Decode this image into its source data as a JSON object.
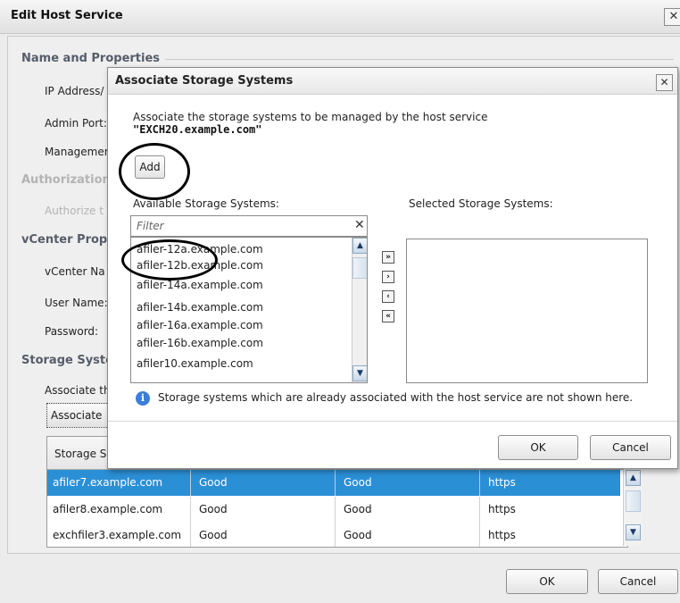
{
  "outer": {
    "title": "Edit Host Service",
    "close_glyph": "✕",
    "sections": {
      "name_properties": "Name and Properties",
      "authorization": "Authorization",
      "vcenter": "vCenter Prope",
      "storage": "Storage Syste"
    },
    "fields": {
      "ip_address": "IP Address/",
      "admin_port": "Admin Port:",
      "management": "Managemer",
      "authorize": "Authorize t",
      "vcenter_name": "vCenter Na",
      "user_name": "User Name:",
      "password": "Password:",
      "associate_text": "Associate th"
    },
    "associate_button": "Associate",
    "storage_table": {
      "header_first": "Storage S",
      "rows": [
        {
          "name": "afiler7.example.com",
          "status1": "Good",
          "status2": "Good",
          "protocol": "https",
          "selected": true
        },
        {
          "name": "afiler8.example.com",
          "status1": "Good",
          "status2": "Good",
          "protocol": "https",
          "selected": false
        },
        {
          "name": "exchfiler3.example.com",
          "status1": "Good",
          "status2": "Good",
          "protocol": "https",
          "selected": false
        }
      ]
    },
    "ok": "OK",
    "cancel": "Cancel"
  },
  "dialog": {
    "title": "Associate Storage Systems",
    "close_glyph": "✕",
    "description": "Associate the storage systems to be managed by the host service",
    "host": "\"EXCH20.example.com\"",
    "add_button": "Add",
    "available_label": "Available Storage Systems:",
    "selected_label": "Selected Storage Systems:",
    "filter_placeholder": "Filter",
    "filter_clear": "✕",
    "available": [
      "afiler-12a.example.com",
      "afiler-12b.example.com",
      "afiler-14a.example.com",
      "afiler-14b.example.com",
      "afiler-16a.example.com",
      "afiler-16b.example.com",
      "afiler10.example.com"
    ],
    "selected": [],
    "move_buttons": {
      "add_all": "»",
      "add": "›",
      "remove": "‹",
      "remove_all": "«"
    },
    "info": "Storage systems which are already associated with the host service are not shown here.",
    "ok": "OK",
    "cancel": "Cancel"
  }
}
